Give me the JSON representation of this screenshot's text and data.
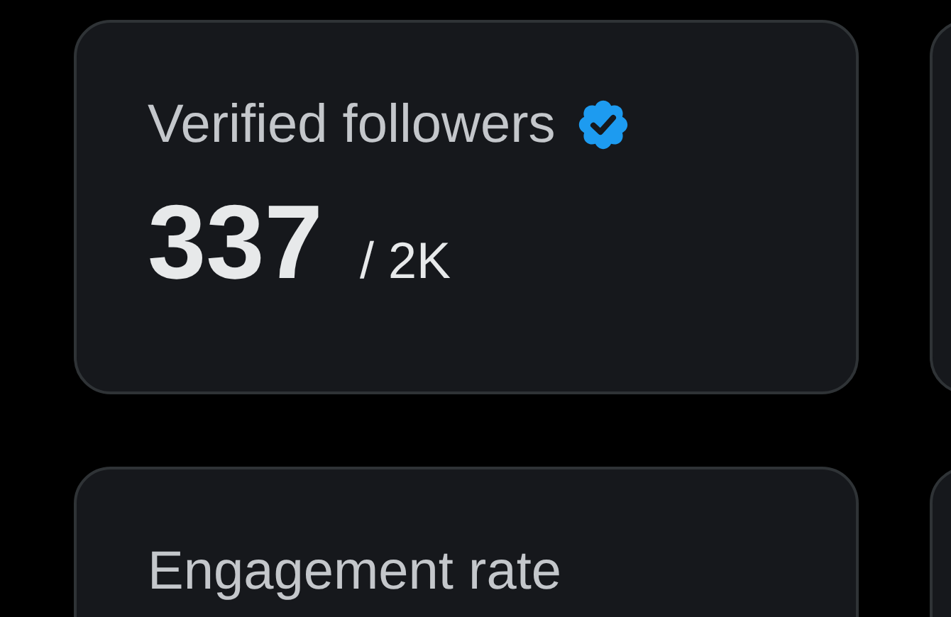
{
  "cards": [
    {
      "title": "Verified followers",
      "verified": true,
      "value": "337",
      "total": "/ 2K"
    },
    {
      "title": "Engagement rate",
      "verified": false
    }
  ]
}
